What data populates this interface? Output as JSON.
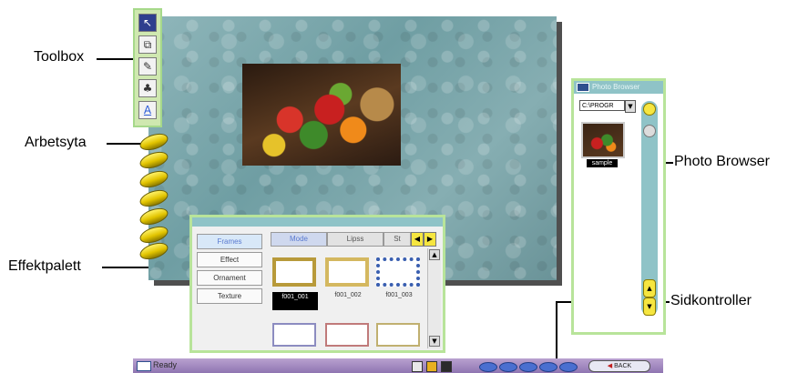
{
  "callouts": {
    "toolbox": "Toolbox",
    "arbetsyta": "Arbetsyta",
    "effektpalett": "Effektpalett",
    "photo_browser": "Photo Browser",
    "sidkontroller": "Sidkontroller"
  },
  "toolbox": {
    "tools": [
      {
        "name": "select",
        "glyph": "↖"
      },
      {
        "name": "crop",
        "glyph": "⧉"
      },
      {
        "name": "brush",
        "glyph": "✎"
      },
      {
        "name": "fill",
        "glyph": "♣"
      },
      {
        "name": "text",
        "glyph": "A"
      }
    ]
  },
  "effect_palette": {
    "categories": [
      "Frames",
      "Effect",
      "Ornament",
      "Texture"
    ],
    "tabs": [
      "Mode",
      "Lipss",
      "St"
    ],
    "thumbnails": [
      "f001_001",
      "f001_002",
      "f001_003"
    ]
  },
  "photo_browser": {
    "title": "Photo Browser",
    "path": "C:\\PROGR",
    "thumb_label": "sample"
  },
  "statusbar": {
    "status": "Ready",
    "button_label": "BACK"
  },
  "colors": {
    "panel_border": "#b8e49a",
    "title_teal": "#8fc3c7",
    "workspace": "#7ea7ab",
    "statusbar": "#a58cc2",
    "spiral": "#e2c400"
  }
}
